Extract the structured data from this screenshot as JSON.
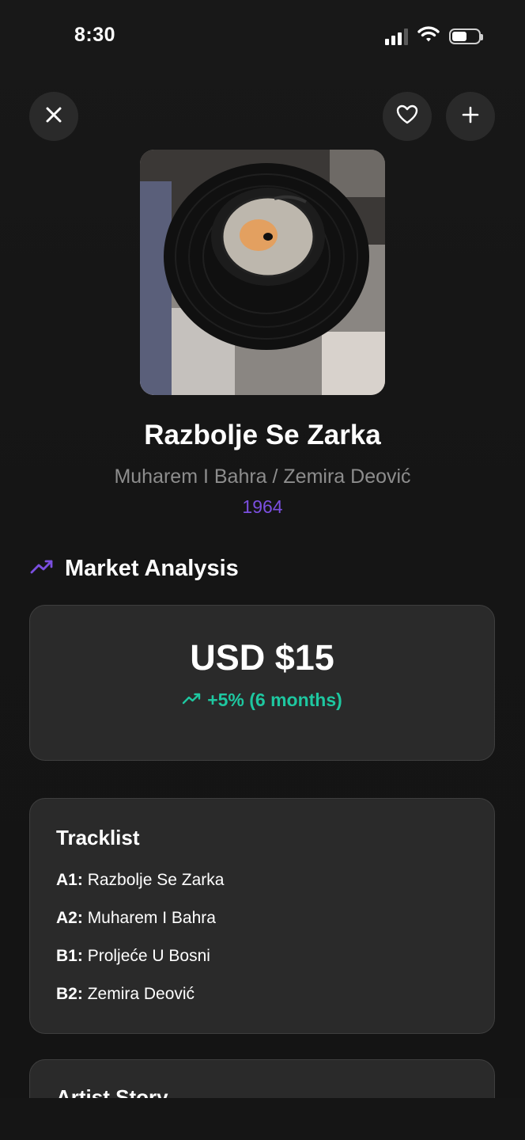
{
  "status_bar": {
    "time": "8:30"
  },
  "top_bar": {
    "close_icon": "close-icon",
    "favorite_icon": "heart-icon",
    "add_icon": "plus-icon"
  },
  "record": {
    "title": "Razbolje Se Zarka",
    "artist": "Muharem I Bahra / Zemira Deović",
    "year": "1964"
  },
  "market_analysis": {
    "heading": "Market Analysis",
    "price": "USD $15",
    "change": "+5% (6 months)",
    "accent_color": "#7b4fe0",
    "positive_color": "#1ec7a0"
  },
  "tracklist": {
    "heading": "Tracklist",
    "tracks": [
      {
        "position": "A1:",
        "name": "Razbolje Se Zarka"
      },
      {
        "position": "A2:",
        "name": "Muharem I Bahra"
      },
      {
        "position": "B1:",
        "name": "Proljeće U Bosni"
      },
      {
        "position": "B2:",
        "name": "Zemira Deović"
      }
    ]
  },
  "artist_story": {
    "heading": "Artist Story"
  }
}
